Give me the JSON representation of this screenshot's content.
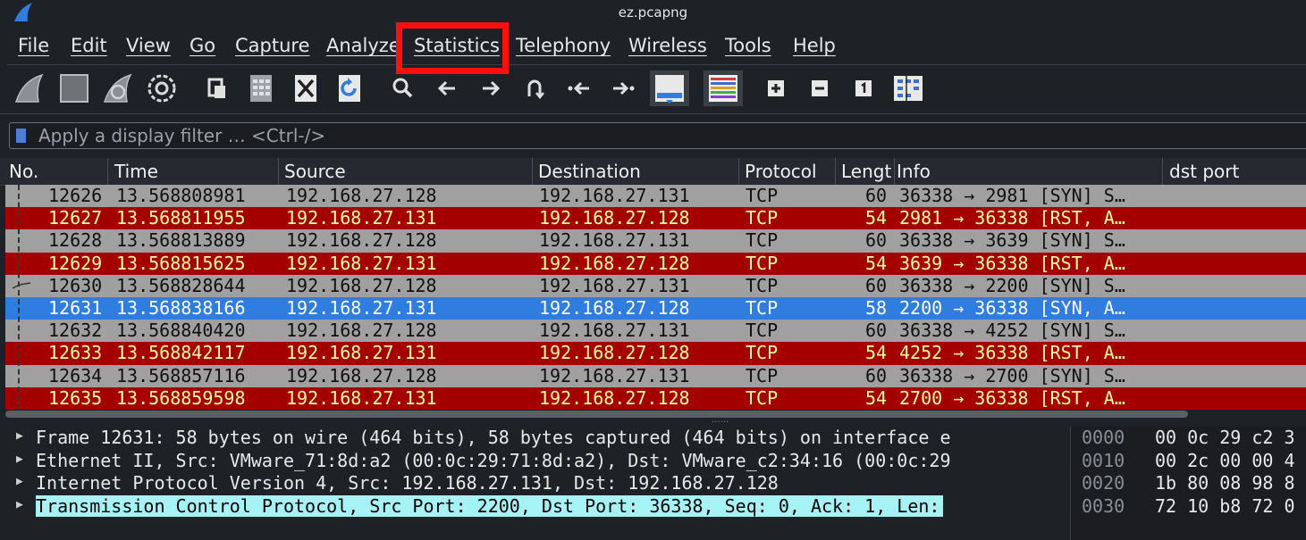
{
  "window": {
    "title": "ez.pcapng",
    "logo_icon": "wireshark-fin-icon"
  },
  "menu": [
    "File",
    "Edit",
    "View",
    "Go",
    "Capture",
    "Analyze",
    "Statistics",
    "Telephony",
    "Wireless",
    "Tools",
    "Help"
  ],
  "highlighted_menu": "Statistics",
  "highlight_color": "#ff1010",
  "toolbar_icons": [
    "start-capture-icon",
    "stop-capture-icon",
    "restart-capture-icon",
    "capture-options-icon",
    "open-file-icon",
    "save-file-icon",
    "close-file-icon",
    "reload-file-icon",
    "find-packet-icon",
    "go-back-icon",
    "go-forward-icon",
    "go-to-packet-icon",
    "first-packet-icon",
    "last-packet-icon",
    "auto-scroll-icon",
    "colorize-icon",
    "zoom-in-icon",
    "zoom-out-icon",
    "normal-size-icon",
    "resize-columns-icon"
  ],
  "filter": {
    "placeholder": "Apply a display filter … <Ctrl-/>"
  },
  "columns": [
    "No.",
    "Time",
    "Source",
    "Destination",
    "Protocol",
    "Lengt",
    "Info",
    "dst port"
  ],
  "packets": [
    {
      "no": "12626",
      "time": "13.568808981",
      "src": "192.168.27.128",
      "dst": "192.168.27.131",
      "proto": "TCP",
      "len": "60",
      "info": "36338 → 2981 [SYN] S…",
      "type": "syn"
    },
    {
      "no": "12627",
      "time": "13.568811955",
      "src": "192.168.27.131",
      "dst": "192.168.27.128",
      "proto": "TCP",
      "len": "54",
      "info": "2981 → 36338 [RST, A…",
      "type": "rst"
    },
    {
      "no": "12628",
      "time": "13.568813889",
      "src": "192.168.27.128",
      "dst": "192.168.27.131",
      "proto": "TCP",
      "len": "60",
      "info": "36338 → 3639 [SYN] S…",
      "type": "syn"
    },
    {
      "no": "12629",
      "time": "13.568815625",
      "src": "192.168.27.131",
      "dst": "192.168.27.128",
      "proto": "TCP",
      "len": "54",
      "info": "3639 → 36338 [RST, A…",
      "type": "rst"
    },
    {
      "no": "12630",
      "time": "13.568828644",
      "src": "192.168.27.128",
      "dst": "192.168.27.131",
      "proto": "TCP",
      "len": "60",
      "info": "36338 → 2200 [SYN] S…",
      "type": "syn"
    },
    {
      "no": "12631",
      "time": "13.568838166",
      "src": "192.168.27.131",
      "dst": "192.168.27.128",
      "proto": "TCP",
      "len": "58",
      "info": "2200 → 36338 [SYN, A…",
      "type": "sel"
    },
    {
      "no": "12632",
      "time": "13.568840420",
      "src": "192.168.27.128",
      "dst": "192.168.27.131",
      "proto": "TCP",
      "len": "60",
      "info": "36338 → 4252 [SYN] S…",
      "type": "syn"
    },
    {
      "no": "12633",
      "time": "13.568842117",
      "src": "192.168.27.131",
      "dst": "192.168.27.128",
      "proto": "TCP",
      "len": "54",
      "info": "4252 → 36338 [RST, A…",
      "type": "rst"
    },
    {
      "no": "12634",
      "time": "13.568857116",
      "src": "192.168.27.128",
      "dst": "192.168.27.131",
      "proto": "TCP",
      "len": "60",
      "info": "36338 → 2700 [SYN] S…",
      "type": "syn"
    },
    {
      "no": "12635",
      "time": "13.568859598",
      "src": "192.168.27.131",
      "dst": "192.168.27.128",
      "proto": "TCP",
      "len": "54",
      "info": "2700 → 36338 [RST, A…",
      "type": "rst"
    }
  ],
  "details": [
    {
      "text": "Frame 12631: 58 bytes on wire (464 bits), 58 bytes captured (464 bits) on interface e",
      "selected": false
    },
    {
      "text": "Ethernet II, Src: VMware_71:8d:a2 (00:0c:29:71:8d:a2), Dst: VMware_c2:34:16 (00:0c:29",
      "selected": false
    },
    {
      "text": "Internet Protocol Version 4, Src: 192.168.27.131, Dst: 192.168.27.128",
      "selected": false
    },
    {
      "text": "Transmission Control Protocol, Src Port: 2200, Dst Port: 36338, Seq: 0, Ack: 1, Len:",
      "selected": true
    }
  ],
  "hex": [
    {
      "offset": "0000",
      "bytes": "00 0c 29 c2 3"
    },
    {
      "offset": "0010",
      "bytes": "00 2c 00 00 4"
    },
    {
      "offset": "0020",
      "bytes": "1b 80 08 98 8"
    },
    {
      "offset": "0030",
      "bytes": "72 10 b8 72 0"
    }
  ],
  "colors": {
    "syn_row": "#a0a0a0",
    "rst_row": "#a40000",
    "rst_text": "#fffc9c",
    "selected_row": "#2f7de1",
    "detail_selected": "#a6f3f5"
  }
}
